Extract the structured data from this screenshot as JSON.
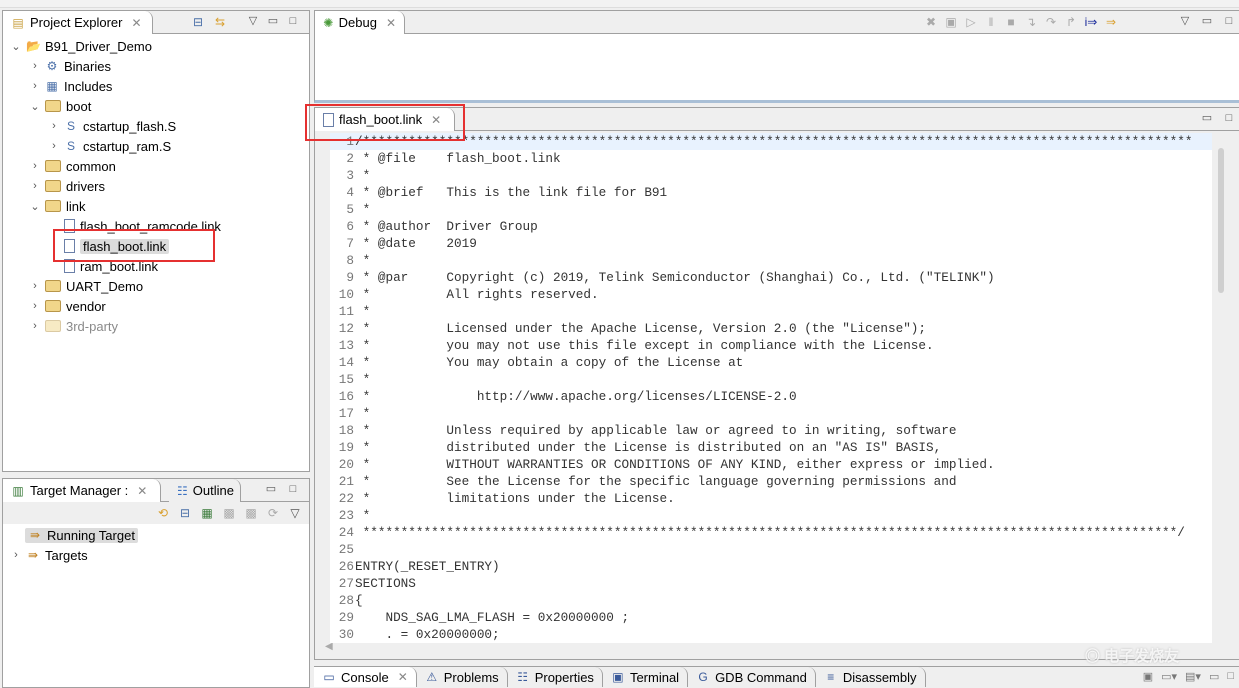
{
  "project_explorer": {
    "title": "Project Explorer",
    "tree": [
      {
        "label": "B91_Driver_Demo",
        "depth": 0,
        "expanded": true,
        "icon": "project-icon"
      },
      {
        "label": "Binaries",
        "depth": 1,
        "expanded": false,
        "icon": "binaries-icon"
      },
      {
        "label": "Includes",
        "depth": 1,
        "expanded": false,
        "icon": "includes-icon"
      },
      {
        "label": "boot",
        "depth": 1,
        "expanded": true,
        "icon": "folder-icon"
      },
      {
        "label": "cstartup_flash.S",
        "depth": 2,
        "expanded": false,
        "icon": "asm-file-icon"
      },
      {
        "label": "cstartup_ram.S",
        "depth": 2,
        "expanded": false,
        "icon": "asm-file-icon"
      },
      {
        "label": "common",
        "depth": 1,
        "expanded": false,
        "icon": "folder-icon"
      },
      {
        "label": "drivers",
        "depth": 1,
        "expanded": false,
        "icon": "folder-icon"
      },
      {
        "label": "link",
        "depth": 1,
        "expanded": true,
        "icon": "folder-icon"
      },
      {
        "label": "flash_boot_ramcode.link",
        "depth": 2,
        "icon": "file-icon"
      },
      {
        "label": "flash_boot.link",
        "depth": 2,
        "icon": "file-icon",
        "selected": true
      },
      {
        "label": "ram_boot.link",
        "depth": 2,
        "icon": "file-icon"
      },
      {
        "label": "UART_Demo",
        "depth": 1,
        "expanded": false,
        "icon": "folder-icon"
      },
      {
        "label": "vendor",
        "depth": 1,
        "expanded": false,
        "icon": "folder-icon"
      },
      {
        "label": "3rd-party",
        "depth": 1,
        "expanded": false,
        "icon": "folder-icon",
        "disabled": true
      }
    ]
  },
  "target_manager": {
    "tabs": [
      {
        "label": "Target Manager :"
      },
      {
        "label": "Outline"
      }
    ],
    "items": [
      {
        "label": "Running Target",
        "selected": true
      },
      {
        "label": "Targets"
      }
    ]
  },
  "debug": {
    "title": "Debug"
  },
  "editor": {
    "tab": "flash_boot.link",
    "lines": [
      "/*************************************************************************************************************",
      " * @file    flash_boot.link",
      " *",
      " * @brief   This is the link file for B91",
      " *",
      " * @author  Driver Group",
      " * @date    2019",
      " *",
      " * @par     Copyright (c) 2019, Telink Semiconductor (Shanghai) Co., Ltd. (\"TELINK\")",
      " *          All rights reserved.",
      " *",
      " *          Licensed under the Apache License, Version 2.0 (the \"License\");",
      " *          you may not use this file except in compliance with the License.",
      " *          You may obtain a copy of the License at",
      " *",
      " *              http://www.apache.org/licenses/LICENSE-2.0",
      " *",
      " *          Unless required by applicable law or agreed to in writing, software",
      " *          distributed under the License is distributed on an \"AS IS\" BASIS,",
      " *          WITHOUT WARRANTIES OR CONDITIONS OF ANY KIND, either express or implied.",
      " *          See the License for the specific language governing permissions and",
      " *          limitations under the License.",
      " *",
      " ***********************************************************************************************************/",
      "",
      "ENTRY(_RESET_ENTRY)",
      "SECTIONS",
      "{",
      "    NDS_SAG_LMA_FLASH = 0x20000000 ;",
      "    . = 0x20000000;"
    ]
  },
  "bottom_tabs": [
    "Console",
    "Problems",
    "Properties",
    "Terminal",
    "GDB Command",
    "Disassembly"
  ],
  "watermark": "电子发烧友 www.elecfans.com",
  "colors": {
    "highlight_box": "#e53030",
    "current_line": "#e8f2fe"
  }
}
